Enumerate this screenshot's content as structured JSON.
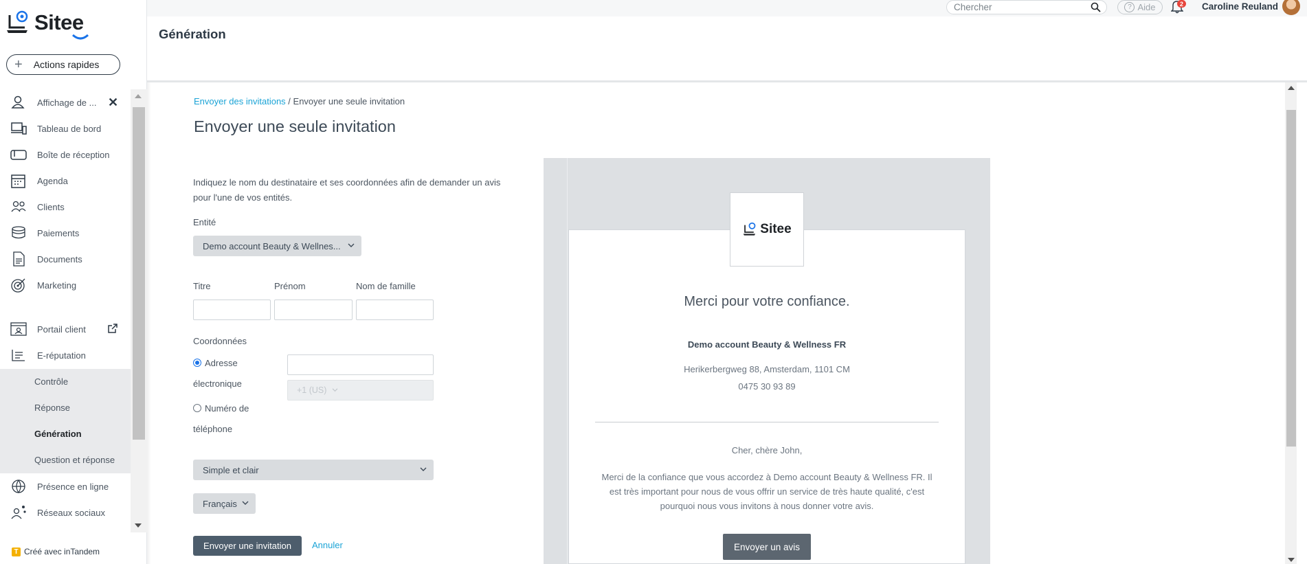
{
  "app": {
    "name": "Sitee",
    "page_header": "Génération"
  },
  "topbar": {
    "search_placeholder": "Chercher",
    "help_label": "Aide",
    "notification_count": "2",
    "user_name": "Caroline Reuland"
  },
  "sidebar": {
    "quick_actions": "Actions rapides",
    "items": [
      {
        "label": "Affichage de ...",
        "icon": "users-icon"
      },
      {
        "label": "Tableau de bord",
        "icon": "dashboard-icon"
      },
      {
        "label": "Boîte de réception",
        "icon": "inbox-icon"
      },
      {
        "label": "Agenda",
        "icon": "calendar-icon"
      },
      {
        "label": "Clients",
        "icon": "clients-icon"
      },
      {
        "label": "Paiements",
        "icon": "coins-icon"
      },
      {
        "label": "Documents",
        "icon": "document-icon"
      },
      {
        "label": "Marketing",
        "icon": "target-icon"
      },
      {
        "label": "Portail client",
        "icon": "portal-icon"
      },
      {
        "label": "E-réputation",
        "icon": "reputation-icon"
      },
      {
        "label": "Présence en ligne",
        "icon": "globe-icon"
      },
      {
        "label": "Réseaux sociaux",
        "icon": "social-icon"
      }
    ],
    "sub_items": [
      {
        "label": "Contrôle"
      },
      {
        "label": "Réponse"
      },
      {
        "label": "Génération"
      },
      {
        "label": "Question et réponse"
      }
    ],
    "footer": "Créé avec inTandem",
    "footer_badge": "T"
  },
  "form": {
    "breadcrumb_link": "Envoyer des invitations",
    "breadcrumb_separator": " / ",
    "breadcrumb_current": "Envoyer une seule invitation",
    "title": "Envoyer une seule invitation",
    "intro": "Indiquez le nom du destinataire et ses coordonnées afin de demander un avis pour l'une de vos entités.",
    "entity_label": "Entité",
    "entity_value": "Demo account Beauty & Wellnes...",
    "title_label": "Titre",
    "first_name_label": "Prénom",
    "last_name_label": "Nom de famille",
    "contact_label": "Coordonnées",
    "email_option_line1": "Adresse",
    "email_option_line2": "électronique",
    "phone_option_line1": "Numéro de",
    "phone_option_line2": "téléphone",
    "phone_prefix": "+1 (US)",
    "template_value": "Simple et clair",
    "language_value": "Français",
    "submit_label": "Envoyer une invitation",
    "cancel_label": "Annuler"
  },
  "preview": {
    "logo_text": "Sitee",
    "heading": "Merci pour votre confiance.",
    "company": "Demo account Beauty & Wellness FR",
    "address": "Herikerbergweg 88, Amsterdam, 1101 CM",
    "phone": "0475 30 93 89",
    "greeting": "Cher, chère John,",
    "body": "Merci de la confiance que vous accordez à Demo account Beauty & Wellness FR. Il est très important pour nous de vous offrir un service de très haute qualité, c'est pourquoi nous vous invitons à nous donner votre avis.",
    "cta": "Envoyer un avis"
  },
  "colors": {
    "accent_link": "#1aa3d6",
    "primary_button": "#4d5d6c",
    "logo_blue": "#1a73e8",
    "notification_red": "#e8453c"
  }
}
